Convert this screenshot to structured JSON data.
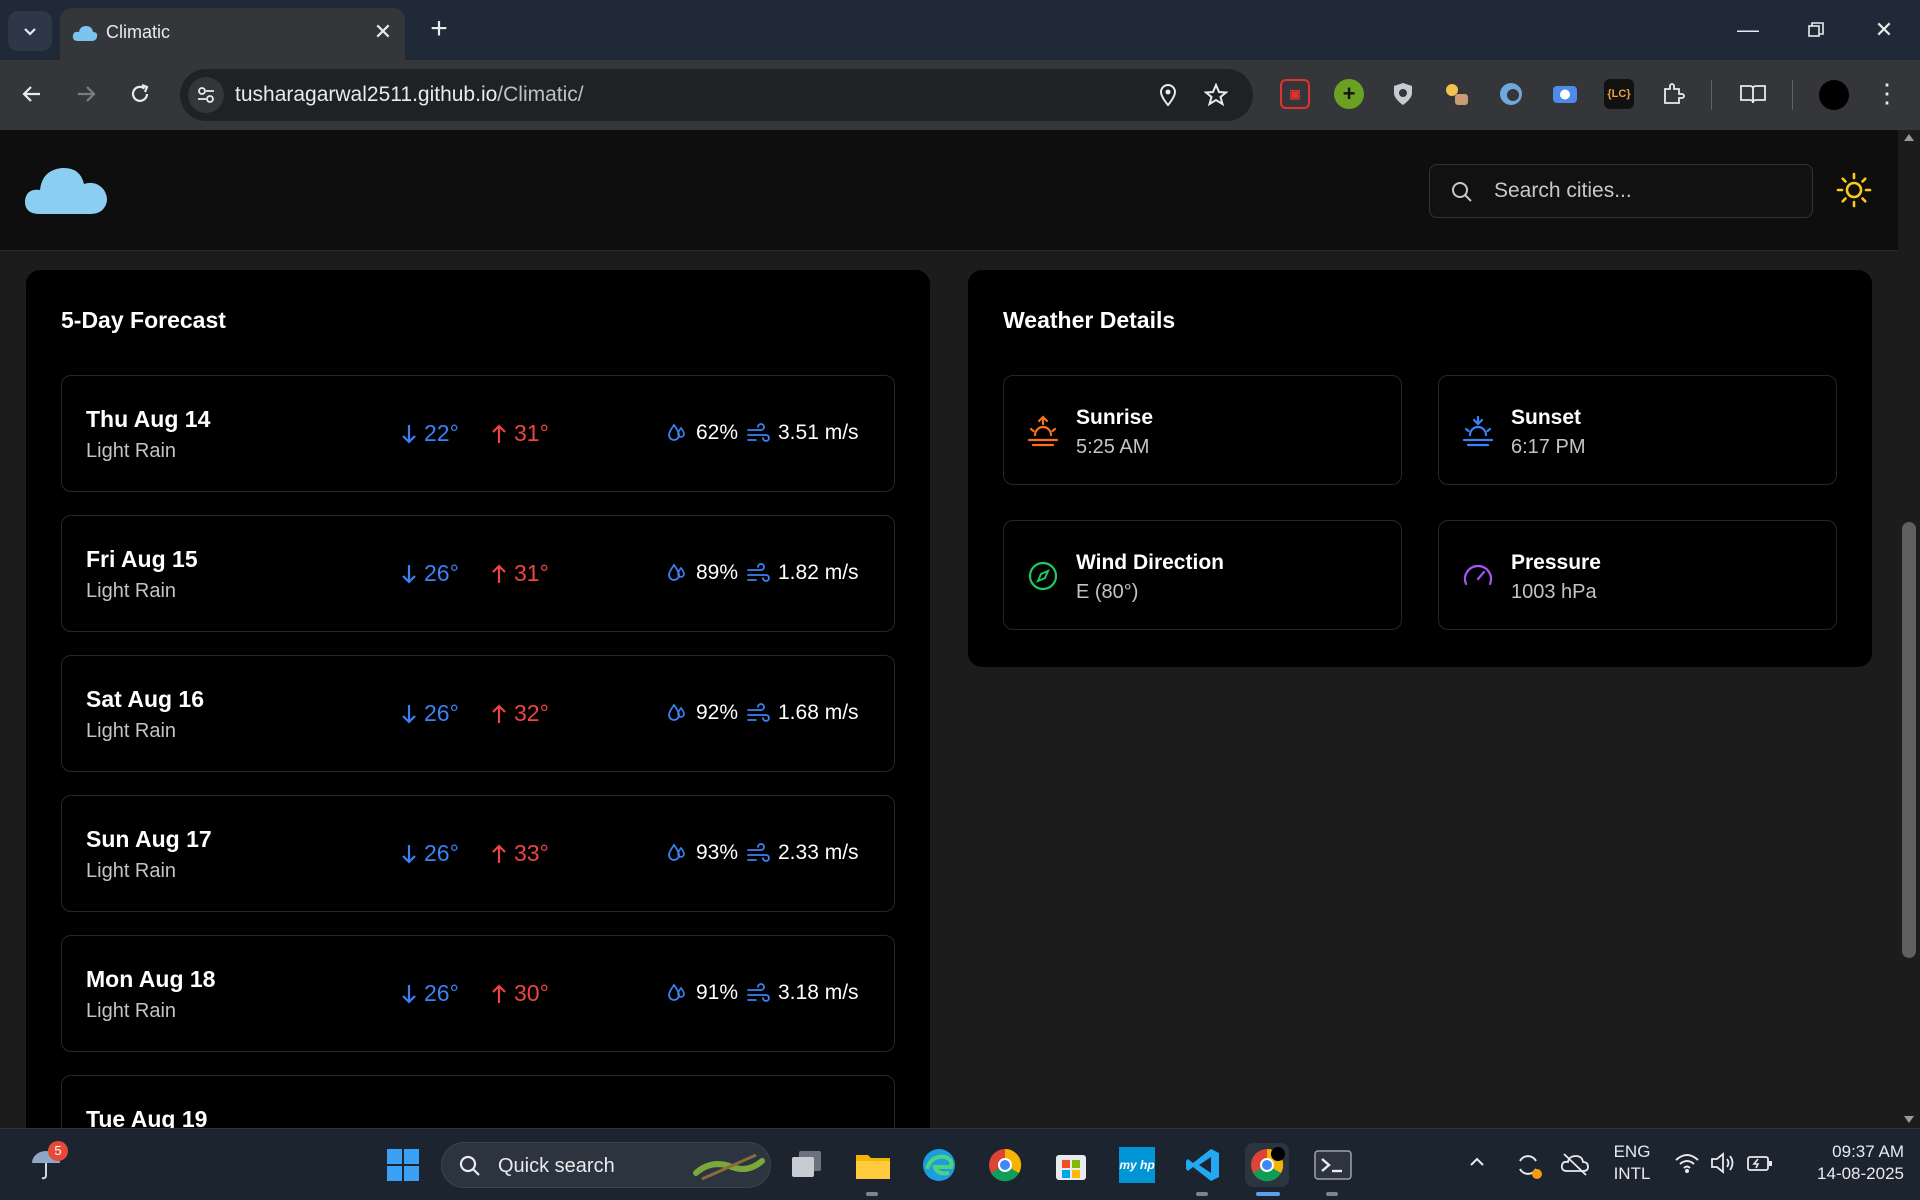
{
  "browser": {
    "tab_title": "Climatic",
    "url_host": "tusharagarwal2511.github.io",
    "url_path": "/Climatic/"
  },
  "app": {
    "search_placeholder": "Search cities..."
  },
  "forecast": {
    "title": "5-Day Forecast",
    "days": [
      {
        "date": "Thu Aug 14",
        "desc": "Light Rain",
        "min": "22°",
        "max": "31°",
        "humidity": "62%",
        "wind": "3.51 m/s"
      },
      {
        "date": "Fri Aug 15",
        "desc": "Light Rain",
        "min": "26°",
        "max": "31°",
        "humidity": "89%",
        "wind": "1.82 m/s"
      },
      {
        "date": "Sat Aug 16",
        "desc": "Light Rain",
        "min": "26°",
        "max": "32°",
        "humidity": "92%",
        "wind": "1.68 m/s"
      },
      {
        "date": "Sun Aug 17",
        "desc": "Light Rain",
        "min": "26°",
        "max": "33°",
        "humidity": "93%",
        "wind": "2.33 m/s"
      },
      {
        "date": "Mon Aug 18",
        "desc": "Light Rain",
        "min": "26°",
        "max": "30°",
        "humidity": "91%",
        "wind": "3.18 m/s"
      },
      {
        "date": "Tue Aug 19"
      }
    ]
  },
  "details": {
    "title": "Weather Details",
    "sunrise": {
      "label": "Sunrise",
      "value": "5:25 AM"
    },
    "sunset": {
      "label": "Sunset",
      "value": "6:17 PM"
    },
    "wind_direction": {
      "label": "Wind Direction",
      "value": "E (80°)"
    },
    "pressure": {
      "label": "Pressure",
      "value": "1003 hPa"
    }
  },
  "taskbar": {
    "weather_badge": "5",
    "search_label": "Quick search",
    "lang_line1": "ENG",
    "lang_line2": "INTL",
    "time": "09:37 AM",
    "date": "14-08-2025"
  },
  "colors": {
    "min_temp": "#3b82f6",
    "max_temp": "#ef4444",
    "sunrise": "#f97316",
    "sunset": "#3b82f6",
    "wind_dir": "#22c55e",
    "pressure": "#a855f7",
    "theme_sun": "#facc15"
  }
}
